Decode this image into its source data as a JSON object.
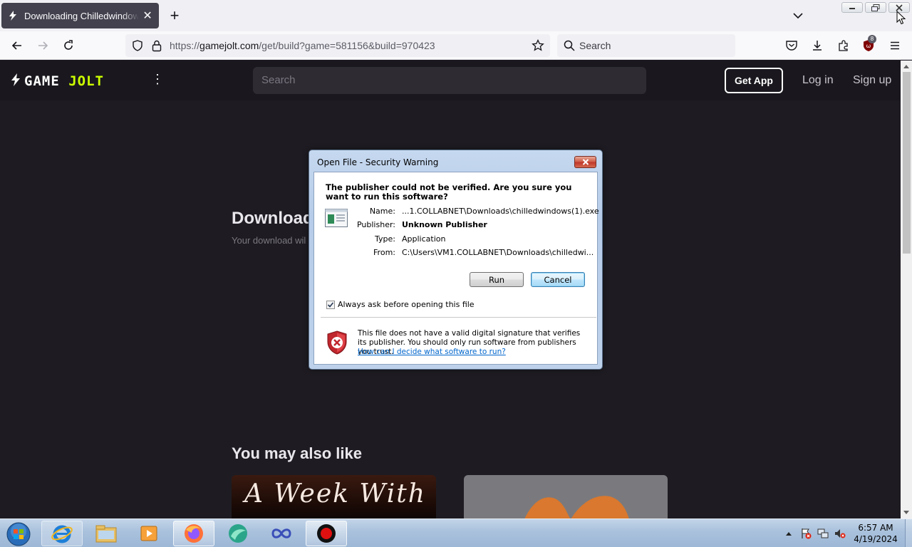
{
  "browser": {
    "tab_title": "Downloading Chilledwindows.exe",
    "tab_close": "✕",
    "new_tab": "+",
    "url_host": "gamejolt.com",
    "url_prefix": "https://",
    "url_path": "/get/build?game=581156&build=970423",
    "search_placeholder": "Search",
    "extension_badge": "8"
  },
  "site": {
    "logo_game": "GAME",
    "logo_jolt": "JOLT",
    "more": "⋮",
    "search_placeholder": "Search",
    "get_app": "Get App",
    "login": "Log in",
    "signup": "Sign up",
    "download_title": "Download",
    "download_subtitle": "Your download wil",
    "also_like": "You may also like",
    "card1_art_text": "A Week With"
  },
  "dialog": {
    "title": "Open File - Security Warning",
    "heading": "The publisher could not be verified.  Are you sure you want to run this software?",
    "fields": [
      {
        "label": "Name:",
        "value": "...1.COLLABNET\\Downloads\\chilledwindows(1).exe",
        "bold": false
      },
      {
        "label": "Publisher:",
        "value": "Unknown Publisher",
        "bold": true
      },
      {
        "label": "Type:",
        "value": "Application",
        "bold": false
      },
      {
        "label": "From:",
        "value": "C:\\Users\\VM1.COLLABNET\\Downloads\\chilledwi...",
        "bold": false
      }
    ],
    "run_label": "Run",
    "cancel_label": "Cancel",
    "checkbox_label": "Always ask before opening this file",
    "checkbox_checked": true,
    "warning_text": "This file does not have a valid digital signature that verifies its publisher.  You should only run software from publishers you trust.",
    "warning_link": "How can I decide what software to run?"
  },
  "taskbar": {
    "apps": [
      "internet-explorer",
      "file-explorer",
      "media-player",
      "firefox",
      "app-green",
      "app-infinity",
      "screen-recorder"
    ],
    "time": "6:57 AM",
    "date": "4/19/2024"
  },
  "colors": {
    "page_bg": "#1e1c22",
    "header_bg": "#1a181e",
    "jolt_accent": "#ccff00",
    "link": "#0066cc"
  }
}
